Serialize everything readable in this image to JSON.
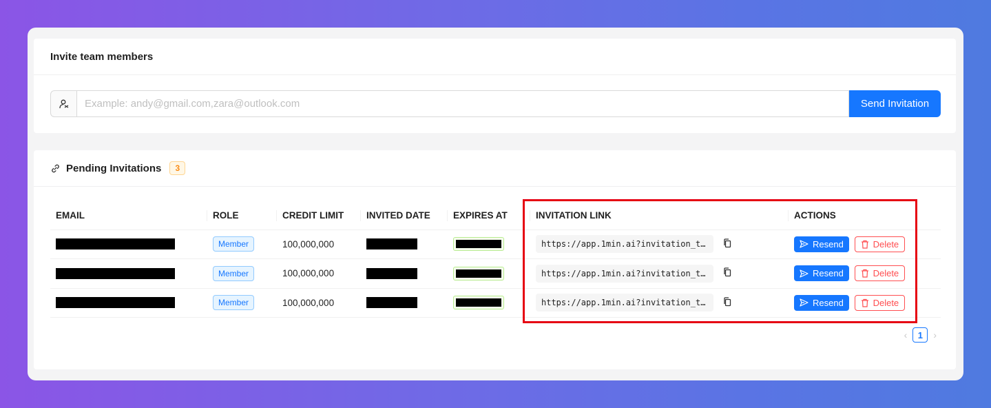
{
  "invite": {
    "title": "Invite team members",
    "input_placeholder": "Example: andy@gmail.com,zara@outlook.com",
    "send_label": "Send Invitation"
  },
  "pending": {
    "title": "Pending Invitations",
    "count": "3",
    "columns": [
      "EMAIL",
      "ROLE",
      "CREDIT LIMIT",
      "INVITED DATE",
      "EXPIRES AT",
      "INVITATION LINK",
      "ACTIONS"
    ],
    "rows": [
      {
        "role": "Member",
        "credit_limit": "100,000,000",
        "link": "https://app.1min.ai?invitation_to…"
      },
      {
        "role": "Member",
        "credit_limit": "100,000,000",
        "link": "https://app.1min.ai?invitation_to…"
      },
      {
        "role": "Member",
        "credit_limit": "100,000,000",
        "link": "https://app.1min.ai?invitation_to…"
      }
    ],
    "resend_label": "Resend",
    "delete_label": "Delete",
    "current_page": "1",
    "prev_arrow": "‹",
    "next_arrow": "›"
  },
  "colors": {
    "primary": "#1677ff",
    "danger": "#ff4d4f",
    "highlight": "#e60012",
    "badge": "#fa8c16"
  }
}
